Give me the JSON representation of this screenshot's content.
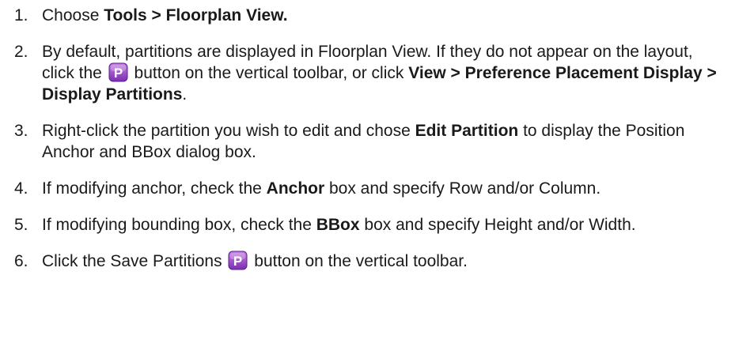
{
  "steps": [
    {
      "num": "1.",
      "parts": [
        {
          "t": "Choose "
        },
        {
          "t": "Tools > Floorplan View.",
          "b": true
        }
      ]
    },
    {
      "num": "2.",
      "parts": [
        {
          "t": "By default, partitions are displayed in Floorplan View. If they do not appear on the layout, click the "
        },
        {
          "icon": "partition-p-icon"
        },
        {
          "t": " button on the vertical toolbar, or click "
        },
        {
          "t": "View > Preference Placement Display > Display Partitions",
          "b": true
        },
        {
          "t": "."
        }
      ]
    },
    {
      "num": "3.",
      "parts": [
        {
          "t": "Right-click the partition you wish to edit and chose "
        },
        {
          "t": "Edit Partition",
          "b": true
        },
        {
          "t": " to display the Position Anchor and BBox dialog box."
        }
      ]
    },
    {
      "num": "4.",
      "parts": [
        {
          "t": "If modifying anchor, check the "
        },
        {
          "t": "Anchor",
          "b": true
        },
        {
          "t": " box and specify Row and/or Column."
        }
      ]
    },
    {
      "num": "5.",
      "parts": [
        {
          "t": "If modifying bounding box, check the "
        },
        {
          "t": "BBox",
          "b": true
        },
        {
          "t": " box and specify Height and/or Width."
        }
      ]
    },
    {
      "num": "6.",
      "parts": [
        {
          "t": "Click the Save Partitions "
        },
        {
          "icon": "partition-p-icon"
        },
        {
          "t": " button on the vertical toolbar."
        }
      ]
    }
  ],
  "icon_glyph": "P",
  "colors": {
    "icon_top": "#c77ee3",
    "icon_bottom": "#7a2fb0",
    "icon_border": "#5c1f8a",
    "icon_letter": "#ffffff"
  }
}
